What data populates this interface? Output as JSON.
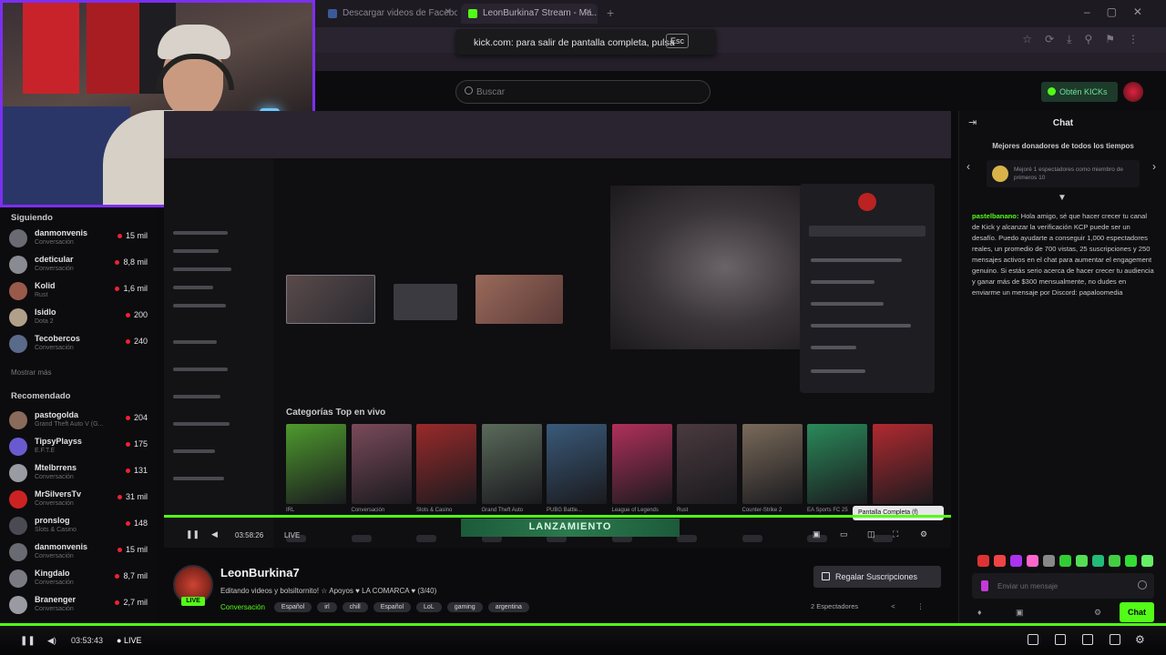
{
  "browser": {
    "tabs": [
      {
        "title": "Descargar videos de Facebook"
      },
      {
        "title": "LeonBurkina7 Stream - Ma..."
      }
    ],
    "toast": {
      "text": "kick.com: para salir de pantalla completa, pulsa",
      "key": "Esc"
    }
  },
  "header": {
    "search_placeholder": "Buscar",
    "get_kicks": "Obtén KICKs"
  },
  "sidebar": {
    "following_title": "Siguiendo",
    "following": [
      {
        "name": "danmonvenis",
        "sub": "Conversación",
        "viewers": "15 mil"
      },
      {
        "name": "cdeticular",
        "sub": "Conversación",
        "viewers": "8,8 mil"
      },
      {
        "name": "Kolid",
        "sub": "Rust",
        "viewers": "1,6 mil"
      },
      {
        "name": "Isidlo",
        "sub": "Dota 2",
        "viewers": "200"
      },
      {
        "name": "Tecobercos",
        "sub": "Conversación",
        "viewers": "240"
      }
    ],
    "show_more": "Mostrar más",
    "recommended_title": "Recomendado",
    "recommended": [
      {
        "name": "pastogolda",
        "sub": "Grand Theft Auto V (G...",
        "viewers": "204"
      },
      {
        "name": "TipsyPlayss",
        "sub": "E.F.T.E",
        "viewers": "175"
      },
      {
        "name": "Mtelbrrens",
        "sub": "Conversación",
        "viewers": "131"
      },
      {
        "name": "MrSilversTv",
        "sub": "Conversación",
        "viewers": "31 mil"
      },
      {
        "name": "pronslog",
        "sub": "Slots & Casino",
        "viewers": "148"
      },
      {
        "name": "danmonvenis",
        "sub": "Conversación",
        "viewers": "15 mil"
      },
      {
        "name": "Kingdalo",
        "sub": "Conversación",
        "viewers": "8,7 mil"
      },
      {
        "name": "Branenger",
        "sub": "Conversación",
        "viewers": "2,7 mil"
      }
    ]
  },
  "stream": {
    "categories_title": "Categorías Top en vivo",
    "categories": [
      {
        "name": "IRL",
        "color": "#4e9a2e"
      },
      {
        "name": "Conversación",
        "color": "#7a4a5a"
      },
      {
        "name": "Slots & Casino",
        "color": "#9a2a2a"
      },
      {
        "name": "Grand Theft Auto",
        "color": "#5a6a5a"
      },
      {
        "name": "PUBG Battle...",
        "color": "#3a5a7a"
      },
      {
        "name": "League of Legends",
        "color": "#b0305a"
      },
      {
        "name": "Rust",
        "color": "#4a3a3e"
      },
      {
        "name": "Counter-Strike 2",
        "color": "#7a6a5a"
      },
      {
        "name": "EA Sports FC 25",
        "color": "#2a8a5a"
      },
      {
        "name": "Assassin's...",
        "color": "#b02a30"
      }
    ],
    "tooltip": "Pantalla Completa (f)",
    "banner": "LANZAMIENTO",
    "inner_time": "03:58:26",
    "inner_live": "LIVE"
  },
  "streamer": {
    "name": "LeonBurkina7",
    "live_badge": "LIVE",
    "title": "Editando videos y bolsiltornito! ☆ Apoyos ♥ LA COMARCA ♥ (3/40)",
    "category": "Conversación",
    "tags": [
      "Español",
      "irl",
      "chill",
      "Español",
      "LoL",
      "gaming",
      "argentina"
    ],
    "gift_button": "Regalar Suscripciones",
    "viewers": "2 Espectadores"
  },
  "chat": {
    "title": "Chat",
    "donors_title": "Mejores donadores de todos los tiempos",
    "donor_text": "Mejoré 1 espectadores como miembro de primeros 10",
    "message_user": "pastelbanano:",
    "message_text": " Hola amigo, sé que hacer crecer tu canal de Kick y alcanzar la verificación KCP puede ser un desafío. Puedo ayudarte a conseguir 1,000 espectadores reales, un promedio de 700 vistas, 25 suscripciones y 250 mensajes activos en el chat para aumentar el engagement genuino. Si estás serio acerca de hacer crecer tu audiencia y ganar más de $300 mensualmente, no dudes en enviarme un mensaje por Discord: papaloomedia",
    "input_placeholder": "Enviar un mensaje",
    "send_label": "Chat",
    "emote_colors": [
      "#d33",
      "#e44",
      "#a3e",
      "#f6c",
      "#888",
      "#3c3",
      "#5d5",
      "#2b7",
      "#4c4",
      "#3d3",
      "#6e6"
    ]
  },
  "player": {
    "time": "03:53:43",
    "live": "LIVE"
  }
}
